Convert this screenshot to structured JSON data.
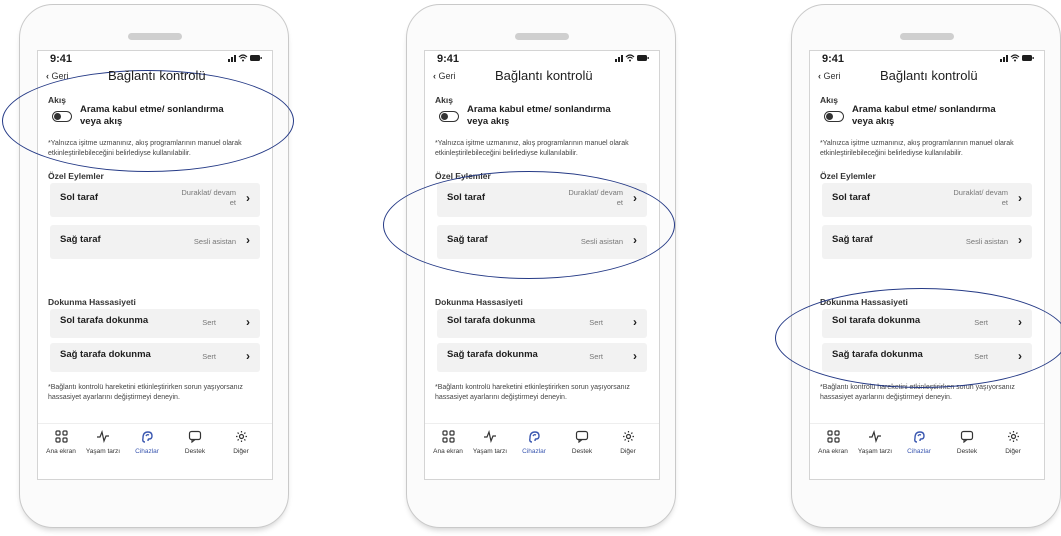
{
  "screens": [
    {
      "status": {
        "time": "9:41",
        "icons": "signal-wifi-battery"
      },
      "nav": {
        "back_label": "Geri",
        "title": "Bağlantı kontrolü"
      },
      "streaming": {
        "label": "Akış",
        "toggle_label": "Arama kabul etme/ sonlandırma veya akış",
        "toggle_on": false,
        "note": "*Yalnızca işitme uzmanınız, akış programlarının manuel olarak etkinleştirilebileceğini belirlediyse kullanılabilir."
      },
      "custom_actions": {
        "label": "Özel Eylemler",
        "items": [
          {
            "label": "Sol taraf",
            "value": "Duraklat/ devam et"
          },
          {
            "label": "Sağ taraf",
            "value": "Sesli asistan"
          }
        ]
      },
      "tap_sensitivity": {
        "label": "Dokunma Hassasiyeti",
        "items": [
          {
            "label": "Sol tarafa dokunma",
            "value": "Sert"
          },
          {
            "label": "Sağ tarafa dokunma",
            "value": "Sert"
          }
        ],
        "note": "*Bağlantı kontrolü hareketini etkinleştirirken sorun yaşıyorsanız hassasiyet ayarlarını değiştirmeyi deneyin."
      },
      "tabs": [
        {
          "label": "Ana ekran",
          "icon": "grid-icon"
        },
        {
          "label": "Yaşam tarzı",
          "icon": "activity-icon"
        },
        {
          "label": "Cihazlar",
          "icon": "hearing-aid-icon",
          "active": true
        },
        {
          "label": "Destek",
          "icon": "chat-icon"
        },
        {
          "label": "Diğer",
          "icon": "gear-icon"
        }
      ],
      "highlight": "streaming"
    },
    {
      "status": {
        "time": "9:41",
        "icons": "signal-wifi-battery"
      },
      "nav": {
        "back_label": "Geri",
        "title": "Bağlantı kontrolü"
      },
      "streaming": {
        "label": "Akış",
        "toggle_label": "Arama kabul etme/ sonlandırma veya akış",
        "toggle_on": false,
        "note": "*Yalnızca işitme uzmanınız, akış programlarının manuel olarak etkinleştirilebileceğini belirlediyse kullanılabilir."
      },
      "custom_actions": {
        "label": "Özel Eylemler",
        "items": [
          {
            "label": "Sol taraf",
            "value": "Duraklat/ devam et"
          },
          {
            "label": "Sağ taraf",
            "value": "Sesli asistan"
          }
        ]
      },
      "tap_sensitivity": {
        "label": "Dokunma Hassasiyeti",
        "items": [
          {
            "label": "Sol tarafa dokunma",
            "value": "Sert"
          },
          {
            "label": "Sağ tarafa dokunma",
            "value": "Sert"
          }
        ],
        "note": "*Bağlantı kontrolü hareketini etkinleştirirken sorun yaşıyorsanız hassasiyet ayarlarını değiştirmeyi deneyin."
      },
      "tabs": [
        {
          "label": "Ana ekran",
          "icon": "grid-icon"
        },
        {
          "label": "Yaşam tarzı",
          "icon": "activity-icon"
        },
        {
          "label": "Cihazlar",
          "icon": "hearing-aid-icon",
          "active": true
        },
        {
          "label": "Destek",
          "icon": "chat-icon"
        },
        {
          "label": "Diğer",
          "icon": "gear-icon"
        }
      ],
      "highlight": "custom_actions"
    },
    {
      "status": {
        "time": "9:41",
        "icons": "signal-wifi-battery"
      },
      "nav": {
        "back_label": "Geri",
        "title": "Bağlantı kontrolü"
      },
      "streaming": {
        "label": "Akış",
        "toggle_label": "Arama kabul etme/ sonlandırma veya akış",
        "toggle_on": false,
        "note": "*Yalnızca işitme uzmanınız, akış programlarının manuel olarak etkinleştirilebileceğini belirlediyse kullanılabilir."
      },
      "custom_actions": {
        "label": "Özel Eylemler",
        "items": [
          {
            "label": "Sol taraf",
            "value": "Duraklat/ devam et"
          },
          {
            "label": "Sağ taraf",
            "value": "Sesli asistan"
          }
        ]
      },
      "tap_sensitivity": {
        "label": "Dokunma Hassasiyeti",
        "items": [
          {
            "label": "Sol tarafa dokunma",
            "value": "Sert"
          },
          {
            "label": "Sağ tarafa dokunma",
            "value": "Sert"
          }
        ],
        "note": "*Bağlantı kontrolü hareketini etkinleştirirken sorun yaşıyorsanız hassasiyet ayarlarını değiştirmeyi deneyin."
      },
      "tabs": [
        {
          "label": "Ana ekran",
          "icon": "grid-icon"
        },
        {
          "label": "Yaşam tarzı",
          "icon": "activity-icon"
        },
        {
          "label": "Cihazlar",
          "icon": "hearing-aid-icon",
          "active": true
        },
        {
          "label": "Destek",
          "icon": "chat-icon"
        },
        {
          "label": "Diğer",
          "icon": "gear-icon"
        }
      ],
      "highlight": "tap_sensitivity"
    }
  ]
}
